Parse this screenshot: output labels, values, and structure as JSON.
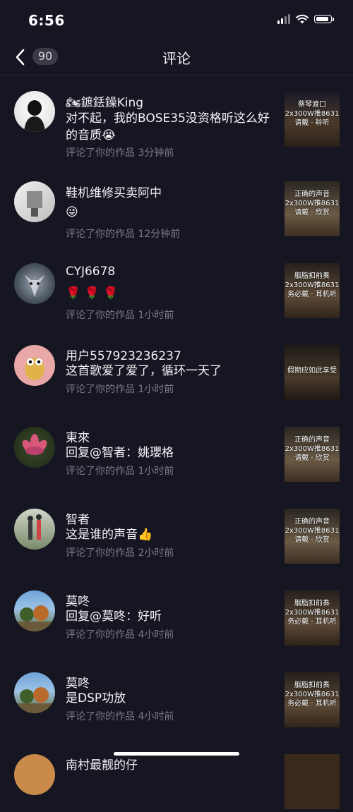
{
  "status_bar": {
    "time": "6:56"
  },
  "header": {
    "count": "90",
    "title": "评论"
  },
  "comments": [
    {
      "name": "🏍鏣銩鐰King",
      "text": "对不起，我的BOSE35没资格听这么好的音质😭",
      "meta": "评论了你的作品 3分钟前",
      "thumb_caption": "蔡琴渡口\n2x300W推8631\n请戴 · 聆听"
    },
    {
      "name": "鞋机维修买卖阿中",
      "text": "😜",
      "meta": "评论了你的作品 12分钟前",
      "thumb_caption": "正确的声音\n2x300W推8631\n请戴 · 欣赏"
    },
    {
      "name": "CYJ6678",
      "text": "🌹 🌹 🌹",
      "meta": "评论了你的作品 1小时前",
      "thumb_caption": "胭脂扣前奏\n2x300W推8631\n务必戴 · 耳机听"
    },
    {
      "name": "用户557923236237",
      "text": "这首歌爱了爱了，循环一天了",
      "meta": "评论了你的作品 1小时前",
      "thumb_caption": "假期应如此享受"
    },
    {
      "name": "東來",
      "text": "回复@智者：姚瓔格",
      "meta": "评论了你的作品 1小时前",
      "thumb_caption": "正确的声音\n2x300W推8631\n请戴 · 欣赏"
    },
    {
      "name": "智者",
      "text": "这是谁的声音👍",
      "meta": "评论了你的作品 2小时前",
      "thumb_caption": "正确的声音\n2x300W推8631\n请戴 · 欣赏"
    },
    {
      "name": "莫咚",
      "text": "回复@莫咚：好听",
      "meta": "评论了你的作品 4小时前",
      "thumb_caption": "胭脂扣前奏\n2x300W推8631\n务必戴 · 耳机听"
    },
    {
      "name": "莫咚",
      "text": "是DSP功放",
      "meta": "评论了你的作品 4小时前",
      "thumb_caption": "胭脂扣前奏\n2x300W推8631\n务必戴 · 耳机听"
    },
    {
      "name": "南村最靓的仔",
      "text": "",
      "meta": "",
      "thumb_caption": ""
    }
  ]
}
